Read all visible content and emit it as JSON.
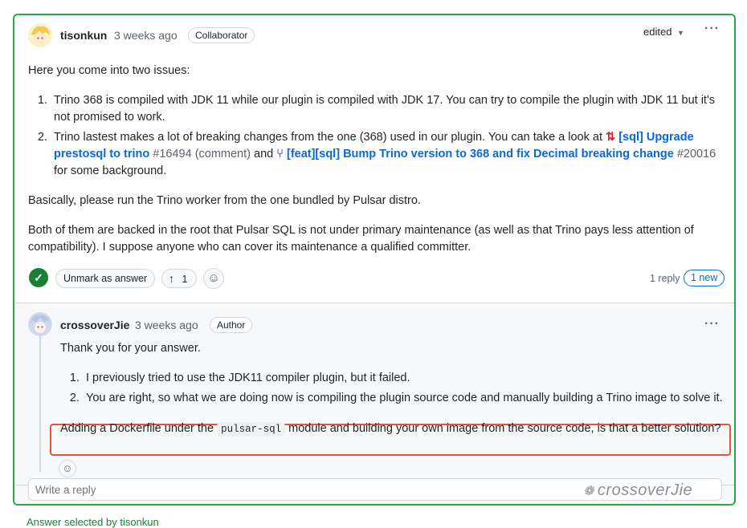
{
  "comment": {
    "author": "tisonkun",
    "time": "3 weeks ago",
    "badge": "Collaborator",
    "edited_label": "edited",
    "intro": "Here you come into two issues:",
    "item1": "Trino 368 is compiled with JDK 11 while our plugin is compiled with JDK 17. You can try to compile the plugin with JDK 11 but it's not promised to work.",
    "item2_pre": "Trino lastest makes a lot of breaking changes from the one (368) used in our plugin. You can take a look at",
    "item2_link1": "[sql] Upgrade prestosql to trino",
    "item2_link1_num": "#16494",
    "item2_link1_suffix": "(comment)",
    "item2_and": "and",
    "item2_link2": "[feat][sql] Bump Trino version to 368 and fix Decimal breaking change",
    "item2_link2_num": "#20016",
    "item2_post": "for some background.",
    "para2": "Basically, please run the Trino worker from the one bundled by Pulsar distro.",
    "para3": "Both of them are backed in the root that Pulsar SQL is not under primary maintenance (as well as that Trino pays less attention of compatibility). I suppose anyone who can cover its maintenance a qualified committer.",
    "unmark_label": "Unmark as answer",
    "upvote_count": "1",
    "reply_count": "1 reply",
    "new_badge": "1 new"
  },
  "reply": {
    "author": "crossoverJie",
    "time": "3 weeks ago",
    "badge": "Author",
    "intro": "Thank you for your answer.",
    "item1": "I previously tried to use the JDK11 compiler plugin, but it failed.",
    "item2": "You are right, so what we are doing now is compiling the plugin source code and manually building a Trino image to solve it.",
    "highlight_pre": "Adding a Dockerfile under the",
    "highlight_code": "pulsar-sql",
    "highlight_post": "module and building your own image from the source code, is that a better solution?"
  },
  "reply_input": {
    "placeholder": "Write a reply"
  },
  "watermark": "crossoverJie",
  "footer_text": "Answer selected by tisonkun",
  "colors": {
    "accent_green": "#2da44e",
    "link_blue": "#0969da",
    "highlight_red": "#e5533d"
  }
}
